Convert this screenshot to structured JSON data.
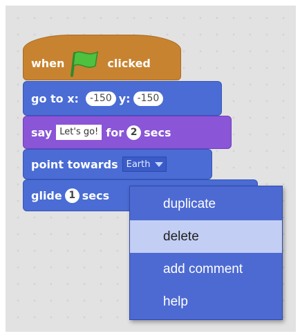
{
  "hat_block": {
    "when_label": "when",
    "clicked_label": "clicked",
    "flag_icon": "green-flag-icon",
    "color": "#c88330"
  },
  "goto_block": {
    "go_label": "go to x:",
    "x_value": "-150",
    "y_label": "y:",
    "y_value": "-150",
    "color": "#4a6cd4"
  },
  "say_block": {
    "say_label": "say",
    "message": "Let's go!",
    "for_label": "for",
    "secs_value": "2",
    "secs_label": "secs",
    "color": "#8a55d7"
  },
  "point_block": {
    "label": "point towards",
    "target": "Earth"
  },
  "glide_block": {
    "label": "glide",
    "secs_value": "1",
    "secs_label": "secs"
  },
  "context_menu": {
    "items": [
      {
        "label": "duplicate"
      },
      {
        "label": "delete"
      },
      {
        "label": "add comment"
      },
      {
        "label": "help"
      }
    ],
    "highlight_color": "#c2cef3"
  }
}
